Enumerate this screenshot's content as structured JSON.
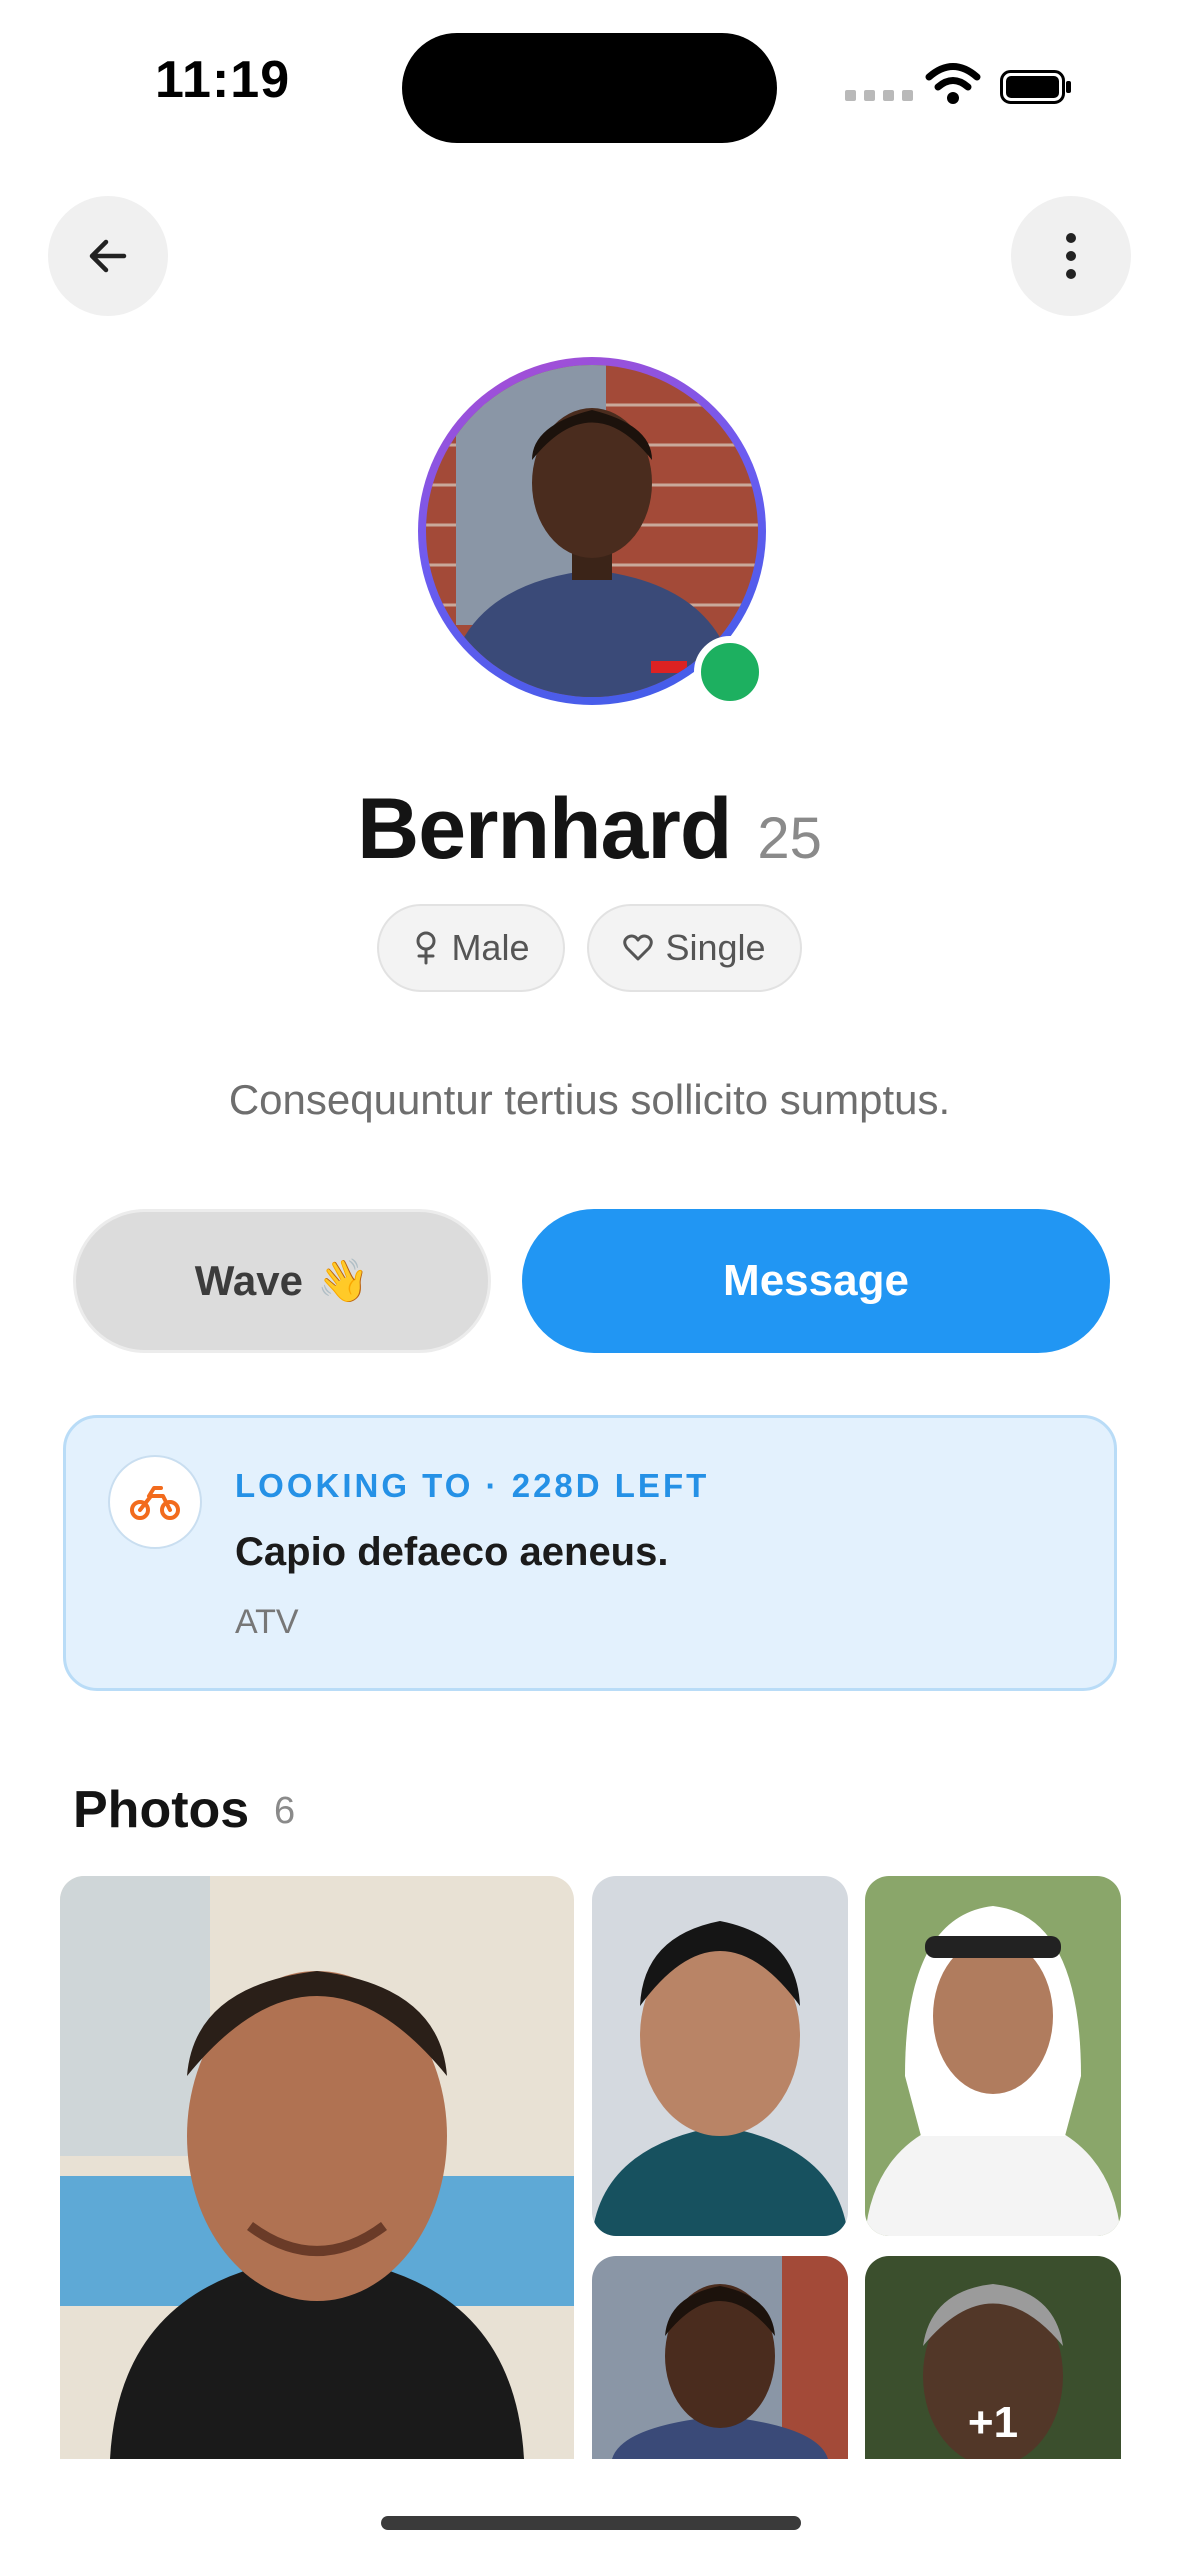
{
  "status": {
    "time": "11:19"
  },
  "nav": {
    "back_icon": "arrow-left-icon",
    "more_icon": "more-vertical-icon"
  },
  "profile": {
    "name": "Bernhard",
    "age": "25",
    "online": true,
    "gender": "Male",
    "relationship": "Single",
    "bio": "Consequuntur tertius sollicito sumptus."
  },
  "actions": {
    "wave_label": "Wave",
    "wave_emoji": "👋",
    "message_label": "Message"
  },
  "looking": {
    "icon": "atv-icon",
    "label": "LOOKING TO · 228D LEFT",
    "title": "Capio defaeco aeneus.",
    "category": "ATV"
  },
  "photos": {
    "title": "Photos",
    "count": "6",
    "more_overlay": "+1"
  },
  "colors": {
    "accent": "#2196f3",
    "online": "#1db060",
    "card_bg": "#e3f1fd",
    "icon_orange": "#f26b1d"
  }
}
